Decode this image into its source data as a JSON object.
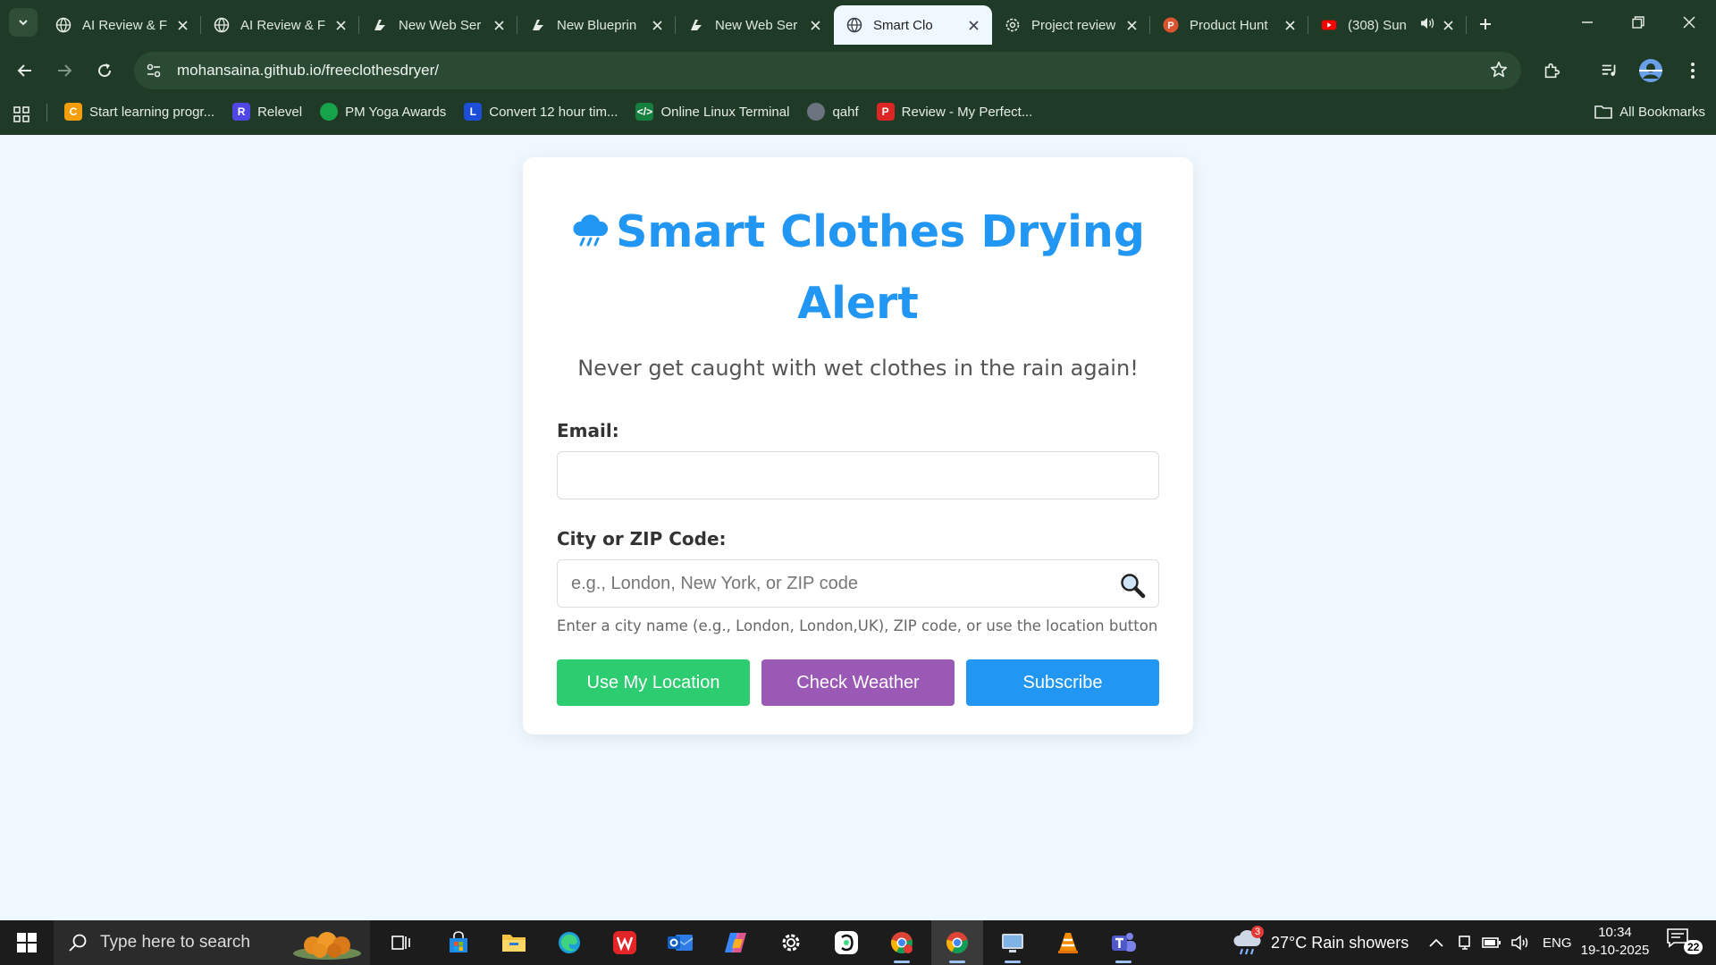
{
  "browser": {
    "tabs": [
      {
        "title": "AI Review & F",
        "icon": "globe-icon"
      },
      {
        "title": "AI Review & F",
        "icon": "globe-icon"
      },
      {
        "title": "New Web Ser",
        "icon": "bolt-app-icon"
      },
      {
        "title": "New Blueprin",
        "icon": "bolt-app-icon"
      },
      {
        "title": "New Web Ser",
        "icon": "bolt-app-icon"
      },
      {
        "title": "Smart Clo",
        "icon": "globe-icon",
        "active": true
      },
      {
        "title": "Project review",
        "icon": "openai-icon"
      },
      {
        "title": "Product Hunt",
        "icon": "producthunt-icon"
      },
      {
        "title": "(308) Sun",
        "icon": "youtube-icon",
        "audio": true
      }
    ],
    "url": "mohansaina.github.io/freeclothesdryer/",
    "bookmarks": [
      {
        "label": "Start learning progr...",
        "color": "#f59e0b",
        "glyph": "C"
      },
      {
        "label": "Relevel",
        "color": "#4f46e5",
        "glyph": "R"
      },
      {
        "label": "PM Yoga Awards",
        "color": "#16a34a",
        "glyph": ""
      },
      {
        "label": "Convert 12 hour tim...",
        "color": "#1d4ed8",
        "glyph": "L"
      },
      {
        "label": "Online Linux Terminal",
        "color": "#15803d",
        "glyph": "</>"
      },
      {
        "label": "qahf",
        "color": "#6b7280",
        "glyph": ""
      },
      {
        "label": "Review - My Perfect...",
        "color": "#dc2626",
        "glyph": "P"
      }
    ],
    "all_bookmarks": "All Bookmarks"
  },
  "page": {
    "title": "Smart Clothes Drying Alert",
    "subtitle": "Never get caught with wet clothes in the rain again!",
    "email_label": "Email:",
    "email_value": "",
    "city_label": "City or ZIP Code:",
    "city_placeholder": "e.g., London, New York, or ZIP code",
    "city_hint": "Enter a city name (e.g., London, London,UK), ZIP code, or use the location button",
    "buttons": {
      "location": "Use My Location",
      "weather": "Check Weather",
      "subscribe": "Subscribe"
    },
    "colors": {
      "accent": "#2196f3",
      "location": "#2ecc71",
      "weather": "#9b59b6",
      "subscribe": "#2196f3"
    }
  },
  "taskbar": {
    "search_placeholder": "Type here to search",
    "weather": "27°C  Rain showers",
    "weather_badge": "3",
    "language": "ENG",
    "time": "10:34",
    "date": "19-10-2025",
    "notification_count": "22"
  }
}
